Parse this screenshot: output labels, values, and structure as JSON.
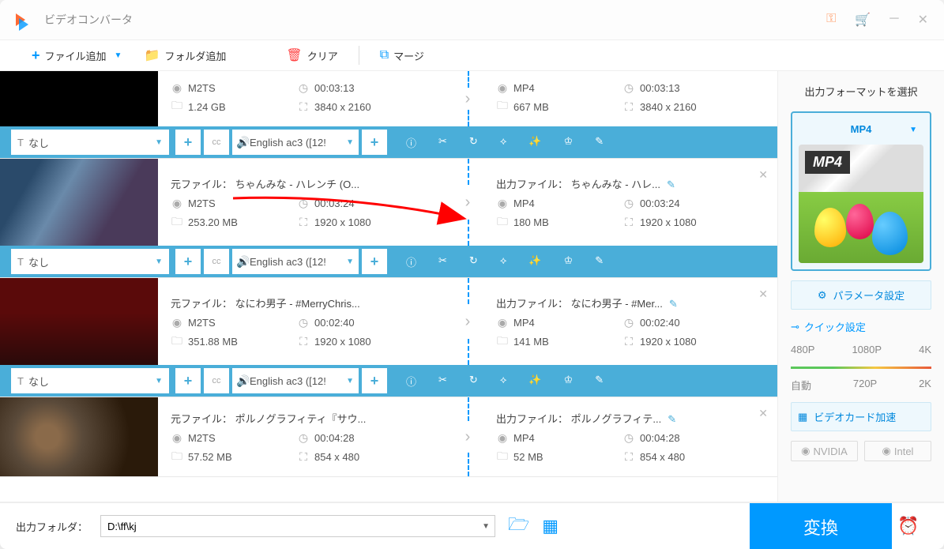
{
  "app": {
    "title": "ビデオコンバータ"
  },
  "toolbar": {
    "add_file": "ファイル追加",
    "add_folder": "フォルダ追加",
    "clear": "クリア",
    "merge": "マージ"
  },
  "subtitle_none": "なし",
  "audio_track": "English ac3 ([12!",
  "items": [
    {
      "src": {
        "format": "M2TS",
        "duration": "00:03:13",
        "size": "1.24 GB",
        "res": "3840 x 2160"
      },
      "out": {
        "format": "MP4",
        "duration": "00:03:13",
        "size": "667 MB",
        "res": "3840 x 2160"
      }
    },
    {
      "src": {
        "title": "元ファイル： ちゃんみな - ハレンチ (O...",
        "format": "M2TS",
        "duration": "00:03:24",
        "size": "253.20 MB",
        "res": "1920 x 1080"
      },
      "out": {
        "title": "出力ファイル： ちゃんみな - ハレ...",
        "format": "MP4",
        "duration": "00:03:24",
        "size": "180 MB",
        "res": "1920 x 1080"
      }
    },
    {
      "src": {
        "title": "元ファイル： なにわ男子 - #MerryChris...",
        "format": "M2TS",
        "duration": "00:02:40",
        "size": "351.88 MB",
        "res": "1920 x 1080"
      },
      "out": {
        "title": "出力ファイル： なにわ男子 - #Mer...",
        "format": "MP4",
        "duration": "00:02:40",
        "size": "141 MB",
        "res": "1920 x 1080"
      }
    },
    {
      "src": {
        "title": "元ファイル： ポルノグラフィティ『サウ...",
        "format": "M2TS",
        "duration": "00:04:28",
        "size": "57.52 MB",
        "res": "854 x 480"
      },
      "out": {
        "title": "出力ファイル： ポルノグラフィテ...",
        "format": "MP4",
        "duration": "00:04:28",
        "size": "52 MB",
        "res": "854 x 480"
      }
    }
  ],
  "sidebar": {
    "title": "出力フォーマットを選択",
    "format": "MP4",
    "format_label": "MP4",
    "params": "パラメータ設定",
    "quick": "クイック設定",
    "res_labels": {
      "auto": "自動",
      "p480": "480P",
      "p720": "720P",
      "p1080": "1080P",
      "k2": "2K",
      "k4": "4K"
    },
    "hw": "ビデオカード加速",
    "nvidia": "NVIDIA",
    "intel": "Intel"
  },
  "bottom": {
    "label": "出力フォルダ：",
    "path": "D:\\ff\\kj",
    "convert": "変換"
  }
}
